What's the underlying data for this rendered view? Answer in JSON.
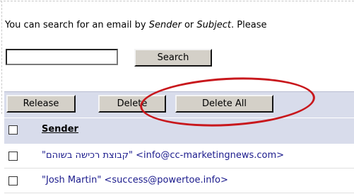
{
  "intro": {
    "prefix": "You can search for an email by ",
    "term1": "Sender",
    "middle": " or ",
    "term2": "Subject",
    "suffix": ". Please"
  },
  "search": {
    "value": "",
    "button_label": "Search"
  },
  "toolbar": {
    "release_label": "Release",
    "delete_label": "Delete",
    "delete_all_label": "Delete All"
  },
  "table": {
    "header": {
      "sender": "Sender"
    },
    "rows": [
      {
        "quote_open": "\"",
        "name": "קבוצת רכישה בשוהם",
        "rest": "\" <info@cc-marketingnews.com>"
      },
      {
        "quote_open": "\"",
        "name": "Josh Martin",
        "rest": "\" <success@powertoe.info>"
      }
    ]
  },
  "colors": {
    "toolbar_bg": "#d8dceb",
    "button_bg": "#d4d0c8",
    "highlight_circle": "#c8171c"
  }
}
